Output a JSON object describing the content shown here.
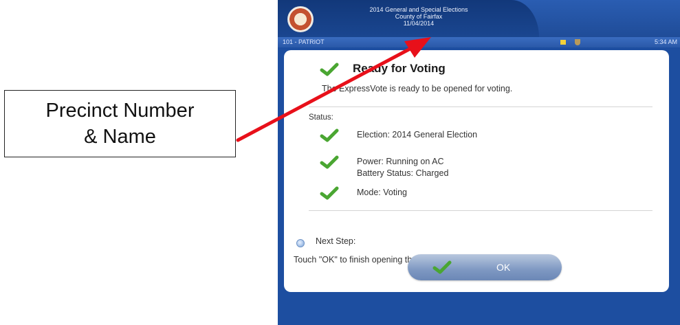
{
  "callout": {
    "line1": "Precinct Number",
    "line2": "& Name"
  },
  "header": {
    "line1": "2014 General and Special Elections",
    "line2": "County of Fairfax",
    "line3": "11/04/2014",
    "seal_icon": "county-seal-icon"
  },
  "statusbar": {
    "precinct": "101 - PATRIOT",
    "time": "5:34 AM",
    "icons": [
      "note-icon",
      "shield-icon"
    ]
  },
  "ready": {
    "title": "Ready for Voting",
    "description": "The ExpressVote is ready to be opened for voting."
  },
  "status": {
    "label": "Status:",
    "election": "Election: 2014 General Election",
    "power": "Power: Running on AC",
    "battery": "Battery Status: Charged",
    "mode": "Mode: Voting"
  },
  "next_step": {
    "label": "Next Step:",
    "description": "Touch \"OK\" to finish opening the ExpressVote."
  },
  "ok_button": {
    "label": "OK"
  },
  "colors": {
    "screen_bg": "#1d4ea0",
    "check_green": "#4aa632",
    "arrow_red": "#e8101a"
  }
}
